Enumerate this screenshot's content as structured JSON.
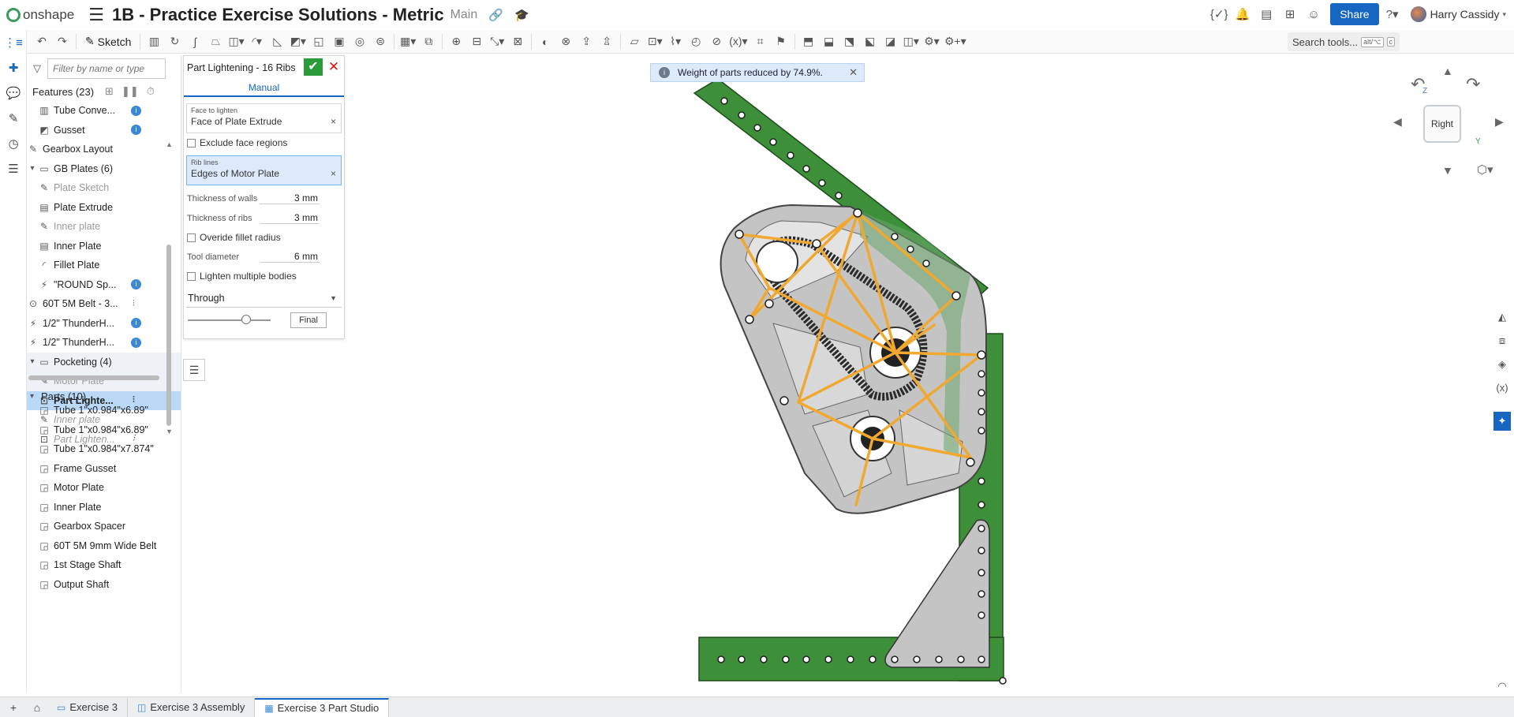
{
  "app": {
    "logo_text": "onshape",
    "doc_title": "1B - Practice Exercise Solutions - Metric",
    "branch": "Main",
    "share_label": "Share",
    "user_name": "Harry Cassidy"
  },
  "toolbar": {
    "sketch_label": "Sketch",
    "search_label": "Search tools...",
    "search_kbd1": "alt/⌥",
    "search_kbd2": "c"
  },
  "features": {
    "filter_placeholder": "Filter by name or type",
    "header": "Features (23)",
    "items": [
      {
        "label": "Tube Conve...",
        "icon": "tube-icon",
        "indent": 1,
        "info": true
      },
      {
        "label": "Gusset",
        "icon": "gusset-icon",
        "indent": 1,
        "info": true
      },
      {
        "label": "Gearbox Layout",
        "icon": "sketch-icon",
        "indent": 0
      },
      {
        "label": "GB Plates (6)",
        "icon": "folder-icon",
        "indent": 0,
        "chevron": true
      },
      {
        "label": "Plate Sketch",
        "icon": "sketch-icon",
        "indent": 1,
        "dim": true
      },
      {
        "label": "Plate Extrude",
        "icon": "extrude-icon",
        "indent": 1
      },
      {
        "label": "Inner plate",
        "icon": "sketch-icon",
        "indent": 1,
        "dim": true
      },
      {
        "label": "Inner Plate",
        "icon": "extrude-icon",
        "indent": 1
      },
      {
        "label": "Fillet Plate",
        "icon": "fillet-icon",
        "indent": 1
      },
      {
        "label": "\"ROUND Sp...",
        "icon": "custom-icon",
        "indent": 1,
        "info": true
      },
      {
        "label": "60T 5M Belt - 3...",
        "icon": "belt-icon",
        "indent": 0,
        "pin": true
      },
      {
        "label": "1/2\" ThunderH...",
        "icon": "custom-icon",
        "indent": 0,
        "info": true
      },
      {
        "label": "1/2\" ThunderH...",
        "icon": "custom-icon",
        "indent": 0,
        "info": true
      },
      {
        "label": "Pocketing (4)",
        "icon": "folder-icon",
        "indent": 0,
        "chevron": true,
        "group": true
      },
      {
        "label": "Motor Plate",
        "icon": "sketch-icon",
        "indent": 1,
        "dim": true,
        "group": true
      },
      {
        "label": "Part Lighte...",
        "icon": "lighten-icon",
        "indent": 1,
        "selected": true,
        "pin": true
      },
      {
        "label": "Inner plate",
        "icon": "sketch-icon",
        "indent": 1,
        "dim": true,
        "italic": true
      },
      {
        "label": "Part Lighten...",
        "icon": "lighten-icon",
        "indent": 1,
        "dim": true,
        "italic": true,
        "pin": true
      }
    ]
  },
  "parts": {
    "header": "Parts (10)",
    "items": [
      "Tube 1\"x0.984\"x6.89\"",
      "Tube 1\"x0.984\"x6.89\"",
      "Tube 1\"x0.984\"x7.874\"",
      "Frame Gusset",
      "Motor Plate",
      "Inner Plate",
      "Gearbox Spacer",
      "60T 5M 9mm Wide Belt",
      "1st Stage Shaft",
      "Output Shaft"
    ]
  },
  "dialog": {
    "title": "Part Lightening - 16 Ribs",
    "tab": "Manual",
    "face_label": "Face to lighten",
    "face_value": "Face of Plate Extrude",
    "exclude_label": "Exclude face regions",
    "rib_label": "Rib lines",
    "rib_value": "Edges of Motor Plate",
    "walls_label": "Thickness of walls",
    "walls_value": "3 mm",
    "ribs_label": "Thickness of ribs",
    "ribs_value": "3 mm",
    "override_label": "Overide fillet radius",
    "tool_label": "Tool diameter",
    "tool_value": "6 mm",
    "multi_label": "Lighten multiple bodies",
    "through_value": "Through",
    "final_label": "Final"
  },
  "notification": {
    "text": "Weight of parts reduced by 74.9%."
  },
  "viewcube": {
    "face": "Right",
    "z_axis": "Z",
    "y_axis": "Y"
  },
  "tabs": [
    {
      "label": "Exercise 3",
      "icon": "folder-icon",
      "active": false
    },
    {
      "label": "Exercise 3 Assembly",
      "icon": "assembly-icon",
      "active": false
    },
    {
      "label": "Exercise 3 Part Studio",
      "icon": "partstudio-icon",
      "active": true
    }
  ],
  "colors": {
    "accent": "#1766c2",
    "frame_green": "#3d8f3a",
    "rib_orange": "#f0a830",
    "plate_gray": "#c4c4c4"
  }
}
